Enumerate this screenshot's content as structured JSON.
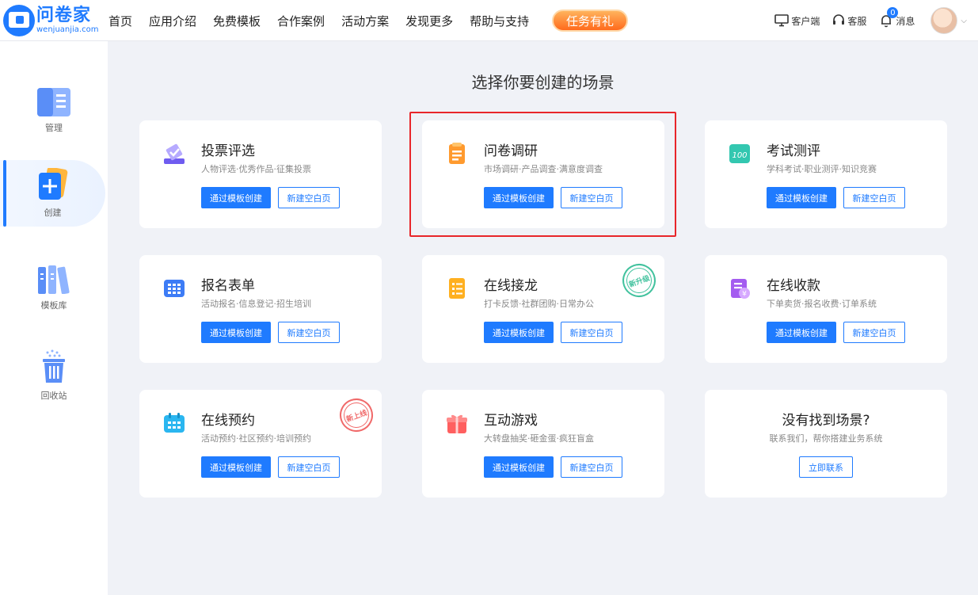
{
  "header": {
    "logo_cn": "问卷家",
    "logo_en": "wenjuanjia.com",
    "nav": [
      "首页",
      "应用介绍",
      "免费模板",
      "合作案例",
      "活动方案",
      "发现更多",
      "帮助与支持"
    ],
    "task_button": "任务有礼",
    "client_label": "客户端",
    "service_label": "客服",
    "message_label": "消息",
    "message_count": "0"
  },
  "sidebar": {
    "items": [
      {
        "label": "管理",
        "icon": "manage-icon"
      },
      {
        "label": "创建",
        "icon": "create-icon"
      },
      {
        "label": "模板库",
        "icon": "template-library-icon"
      },
      {
        "label": "回收站",
        "icon": "recycle-bin-icon"
      }
    ]
  },
  "main": {
    "title": "选择你要创建的场景",
    "primary_button": "通过模板创建",
    "secondary_button": "新建空白页",
    "cards": [
      {
        "title": "投票评选",
        "desc": "人物评选·优秀作品·征集投票",
        "icon": "vote-icon",
        "color": "#6f5cf0"
      },
      {
        "title": "问卷调研",
        "desc": "市场调研·产品调查·满意度调查",
        "icon": "questionnaire-icon",
        "color": "#ff9a2e"
      },
      {
        "title": "考试测评",
        "desc": "学科考试·职业测评·知识竞赛",
        "icon": "exam-icon",
        "color": "#33c7b0"
      },
      {
        "title": "报名表单",
        "desc": "活动报名·信息登记·招生培训",
        "icon": "form-icon",
        "color": "#3d7cf6"
      },
      {
        "title": "在线接龙",
        "desc": "打卡反馈·社群团购·日常办公",
        "icon": "relay-icon",
        "color": "#ffb020",
        "stamp": "新升级"
      },
      {
        "title": "在线收款",
        "desc": "下单卖货·报名收费·订单系统",
        "icon": "payment-icon",
        "color": "#a45cf0"
      },
      {
        "title": "在线预约",
        "desc": "活动预约·社区预约·培训预约",
        "icon": "booking-icon",
        "color": "#2ab6f0",
        "stamp": "新上线"
      },
      {
        "title": "互动游戏",
        "desc": "大转盘抽奖·砸金蛋·疯狂盲盒",
        "icon": "game-gift-icon",
        "color": "#ff5f5f"
      }
    ],
    "not_found": {
      "title": "没有找到场景?",
      "desc": "联系我们，帮你搭建业务系统",
      "button": "立即联系"
    }
  }
}
